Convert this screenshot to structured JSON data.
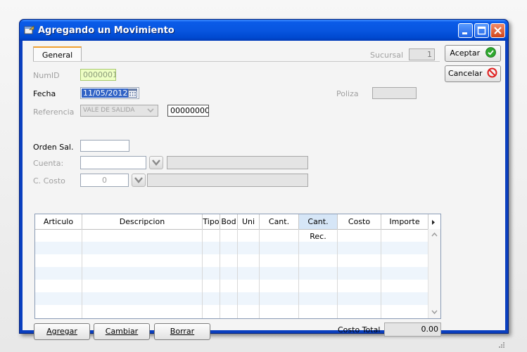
{
  "window": {
    "title": "Agregando un Movimiento"
  },
  "tabs": [
    {
      "label": "General"
    }
  ],
  "sucursal": {
    "label": "Sucursal",
    "value": "1"
  },
  "actions": {
    "accept_label": "Aceptar",
    "cancel_label": "Cancelar"
  },
  "form": {
    "numid": {
      "label": "NumID",
      "value": "0000001"
    },
    "fecha": {
      "label": "Fecha",
      "value": "11/05/2012"
    },
    "poliza": {
      "label": "Poliza",
      "value": ""
    },
    "referencia": {
      "label": "Referencia",
      "value": "VALE DE SALIDA",
      "number": "00000000"
    },
    "orden_sal": {
      "label": "Orden Sal.",
      "value": ""
    },
    "cuenta": {
      "label": "Cuenta:",
      "value": "",
      "description": ""
    },
    "c_costo": {
      "label": "C. Costo",
      "value": "0",
      "description": ""
    }
  },
  "grid": {
    "columns": [
      "Articulo",
      "Descripcion",
      "Tipo",
      "Bod",
      "Uni",
      "Cant.",
      "Cant. Rec.",
      "Costo",
      "Importe"
    ],
    "highlighted_column": "Cant. Rec.",
    "rows": []
  },
  "footer": {
    "add_label": "Agregar",
    "change_label": "Cambiar",
    "delete_label": "Borrar",
    "total_label": "Costo Total",
    "total_value": "0.00"
  },
  "colors": {
    "titlebar": "#0856e0",
    "tab_accent": "#f0a030",
    "accept_icon": "#2ea82e",
    "cancel_icon": "#e02020",
    "numid_bg": "#eeffc4"
  },
  "icons": {
    "window": "app-window-icon",
    "accept": "check-circle-icon",
    "cancel": "no-entry-icon",
    "calendar": "calendar-icon",
    "dropdown": "chevron-down-icon"
  }
}
